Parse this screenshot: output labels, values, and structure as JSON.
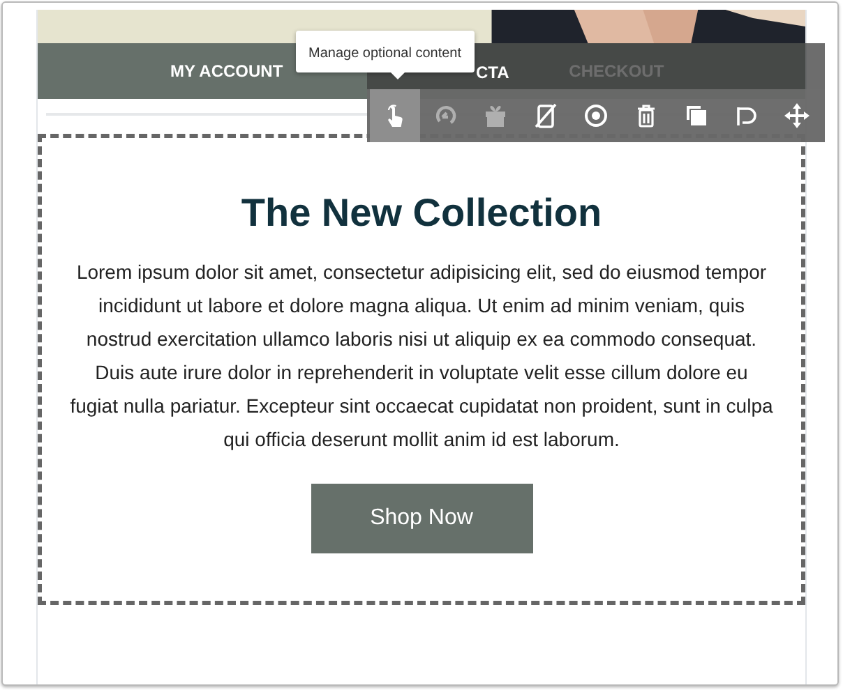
{
  "nav": {
    "items": [
      {
        "label": "MY ACCOUNT"
      },
      {
        "label": "CHECKOUT"
      }
    ]
  },
  "tooltip": {
    "text": "Manage optional content"
  },
  "toolbar": {
    "label": "CTA",
    "tools": [
      {
        "kind": "hand",
        "selected": true,
        "disabled": false
      },
      {
        "kind": "redo",
        "selected": false,
        "disabled": true
      },
      {
        "kind": "gift",
        "selected": false,
        "disabled": true
      },
      {
        "kind": "mobile-off",
        "selected": false,
        "disabled": false
      },
      {
        "kind": "target",
        "selected": false,
        "disabled": false
      },
      {
        "kind": "trash",
        "selected": false,
        "disabled": false
      },
      {
        "kind": "copy",
        "selected": false,
        "disabled": false
      },
      {
        "kind": "undo",
        "selected": false,
        "disabled": false
      },
      {
        "kind": "move",
        "selected": false,
        "disabled": false
      }
    ]
  },
  "section": {
    "title": "The New Collection",
    "body": "Lorem ipsum dolor sit amet, consectetur adipisicing elit, sed do eiusmod tempor incididunt ut labore et dolore magna aliqua. Ut enim ad minim veniam, quis nostrud exercitation ullamco laboris nisi ut aliquip ex ea commodo consequat. Duis aute irure dolor in reprehenderit in voluptate velit esse cillum dolore eu fugiat nulla pariatur. Excepteur sint occaecat cupidatat non proident, sunt in culpa qui officia deserunt mollit anim id est laborum.",
    "button": "Shop Now"
  }
}
